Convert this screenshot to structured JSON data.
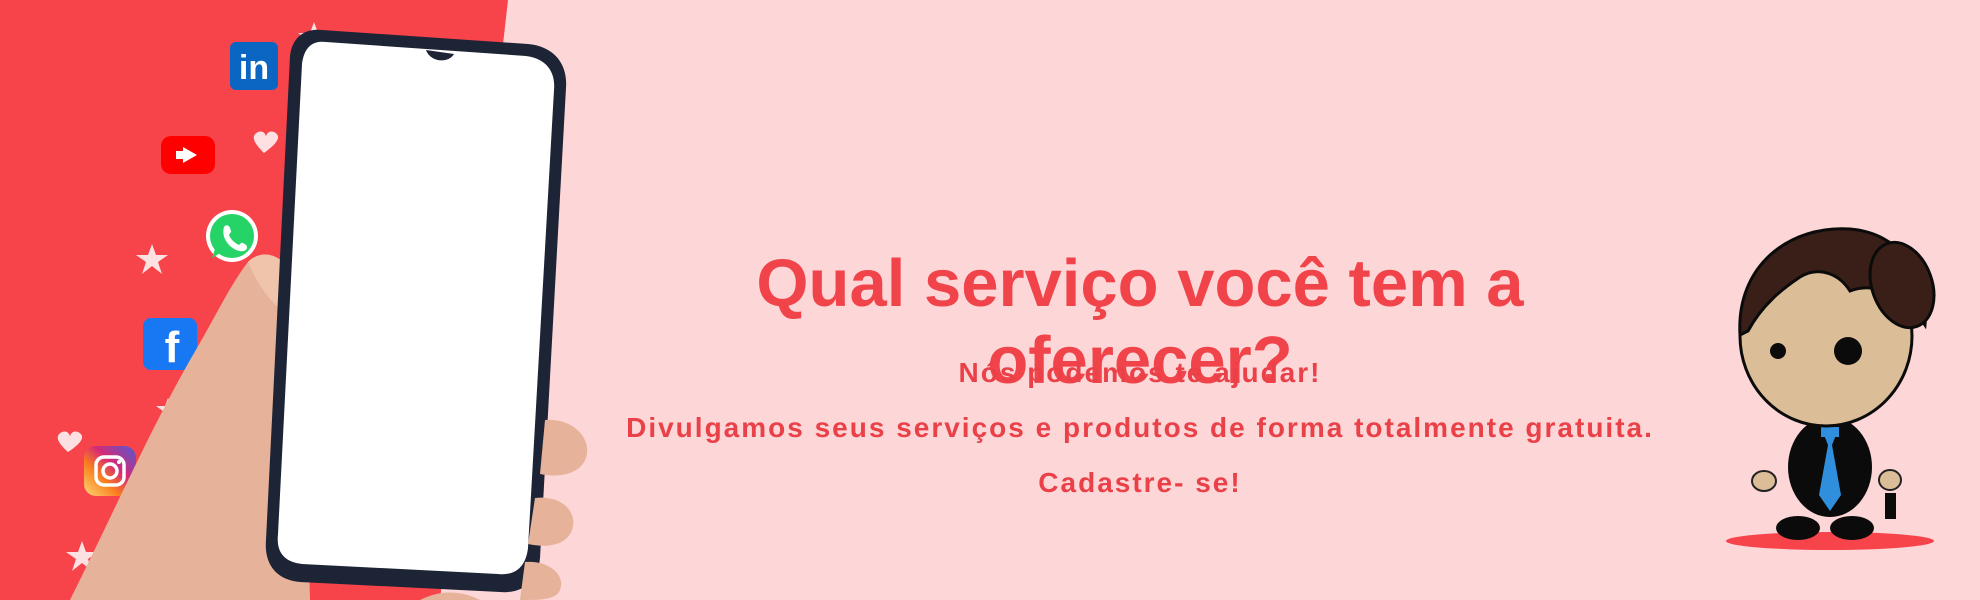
{
  "headline": "Qual serviço você tem a oferecer?",
  "lines": [
    "Nós podemos te ajudar!",
    "Divulgamos seus serviços e produtos de forma totalmente gratuita.",
    "Cadastre- se!"
  ],
  "social_icons": [
    "linkedin-icon",
    "youtube-icon",
    "whatsapp-icon",
    "facebook-icon",
    "instagram-icon"
  ],
  "linkedin_text": "in",
  "facebook_text": "f",
  "colors": {
    "background": "#fdd6d8",
    "left_panel": "#f7434a",
    "text_accent": "#f0434a"
  }
}
